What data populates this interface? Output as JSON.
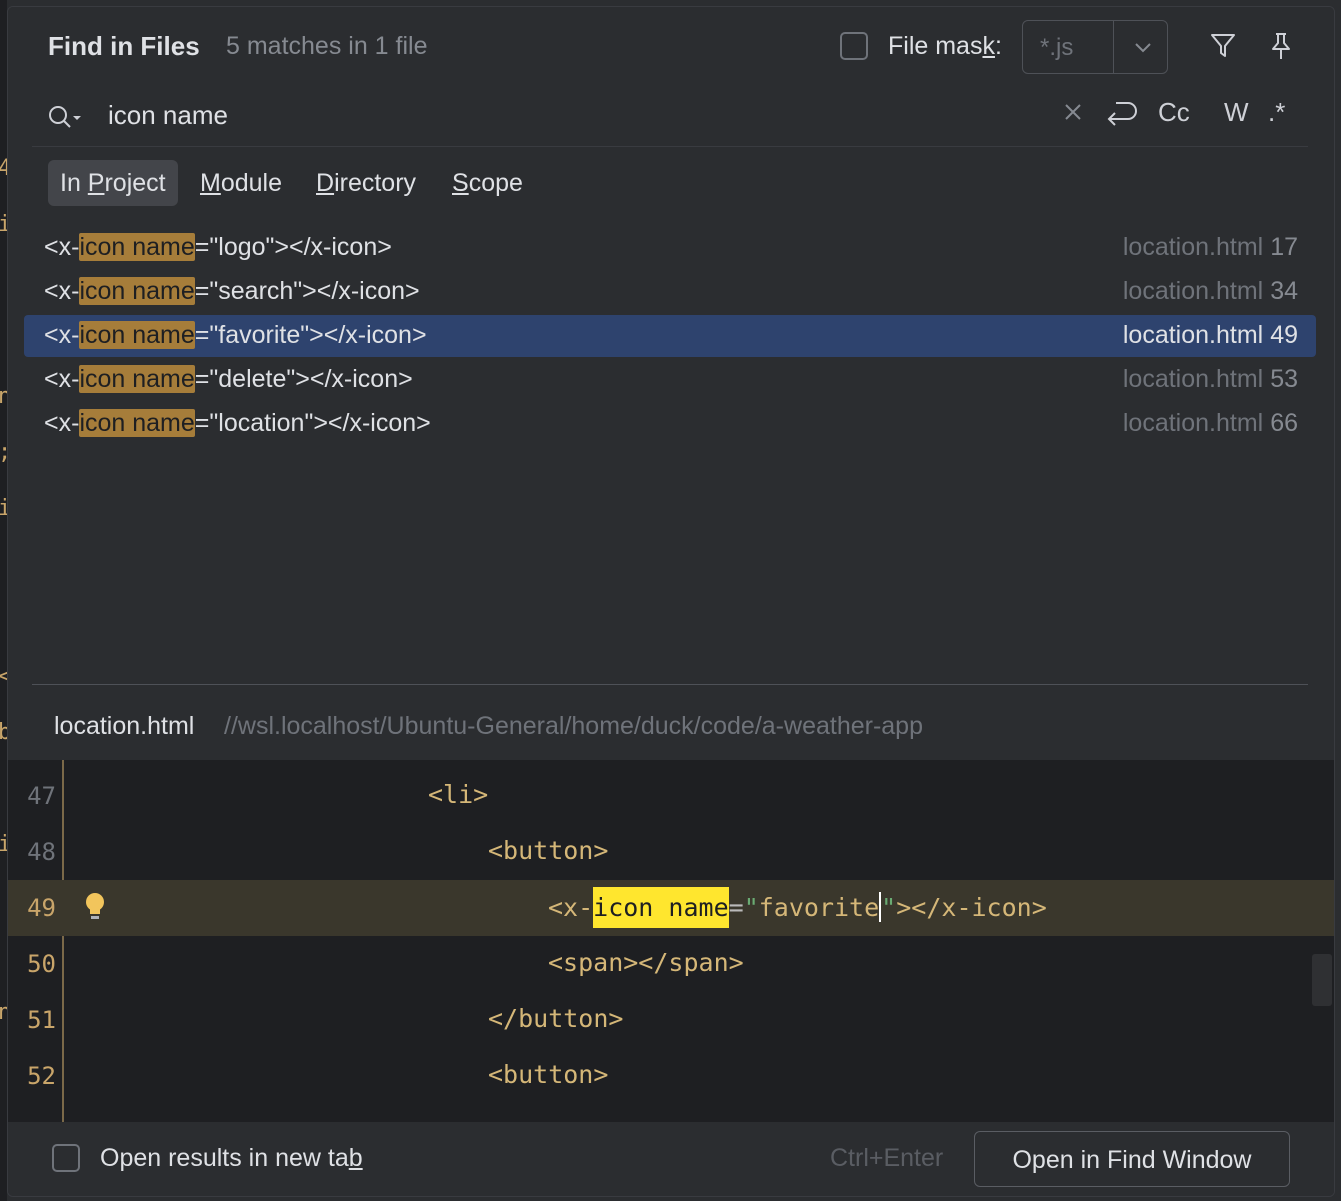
{
  "header": {
    "title": "Find in Files",
    "matches": "5 matches in 1 file",
    "file_mask_label_pre": "File mas",
    "file_mask_label_u": "k",
    "file_mask_label_post": ":",
    "file_mask_placeholder": "*.js"
  },
  "search": {
    "query": "icon name",
    "tool_cc": "Cc",
    "tool_w": "W",
    "tool_regex": ".*"
  },
  "scope_tabs": [
    {
      "pre": "In ",
      "u": "P",
      "post": "roject",
      "active": true
    },
    {
      "pre": "",
      "u": "M",
      "post": "odule",
      "active": false
    },
    {
      "pre": "",
      "u": "D",
      "post": "irectory",
      "active": false
    },
    {
      "pre": "",
      "u": "S",
      "post": "cope",
      "active": false
    }
  ],
  "results": [
    {
      "prefix": "<x-",
      "match": "icon name",
      "suffix": "=\"logo\"></x-icon>",
      "file": "location.html",
      "line": "17"
    },
    {
      "prefix": "<x-",
      "match": "icon name",
      "suffix": "=\"search\"></x-icon>",
      "file": "location.html",
      "line": "34"
    },
    {
      "prefix": "<x-",
      "match": "icon name",
      "suffix": "=\"favorite\"></x-icon>",
      "file": "location.html",
      "line": "49"
    },
    {
      "prefix": "<x-",
      "match": "icon name",
      "suffix": "=\"delete\"></x-icon>",
      "file": "location.html",
      "line": "53"
    },
    {
      "prefix": "<x-",
      "match": "icon name",
      "suffix": "=\"location\"></x-icon>",
      "file": "location.html",
      "line": "66"
    }
  ],
  "preview": {
    "file": "location.html",
    "path": "//wsl.localhost/Ubuntu-General/home/duck/code/a-weather-app",
    "lines": [
      {
        "no": "47",
        "text": "<li>"
      },
      {
        "no": "48",
        "text": "<button>"
      },
      {
        "no": "49",
        "pre": "<x-",
        "mark": "icon name",
        "eq": "=",
        "q1": "\"",
        "val": "favorite",
        "q2": "\"",
        "post": "></x-icon>"
      },
      {
        "no": "50",
        "text": "<span></span>"
      },
      {
        "no": "51",
        "text": "</button>"
      },
      {
        "no": "52",
        "text": "<button>"
      }
    ]
  },
  "footer": {
    "open_new_tab_pre": "Open results in new ta",
    "open_new_tab_u": "b",
    "shortcut": "Ctrl+Enter",
    "open_find_window": "Open in Find Window"
  }
}
